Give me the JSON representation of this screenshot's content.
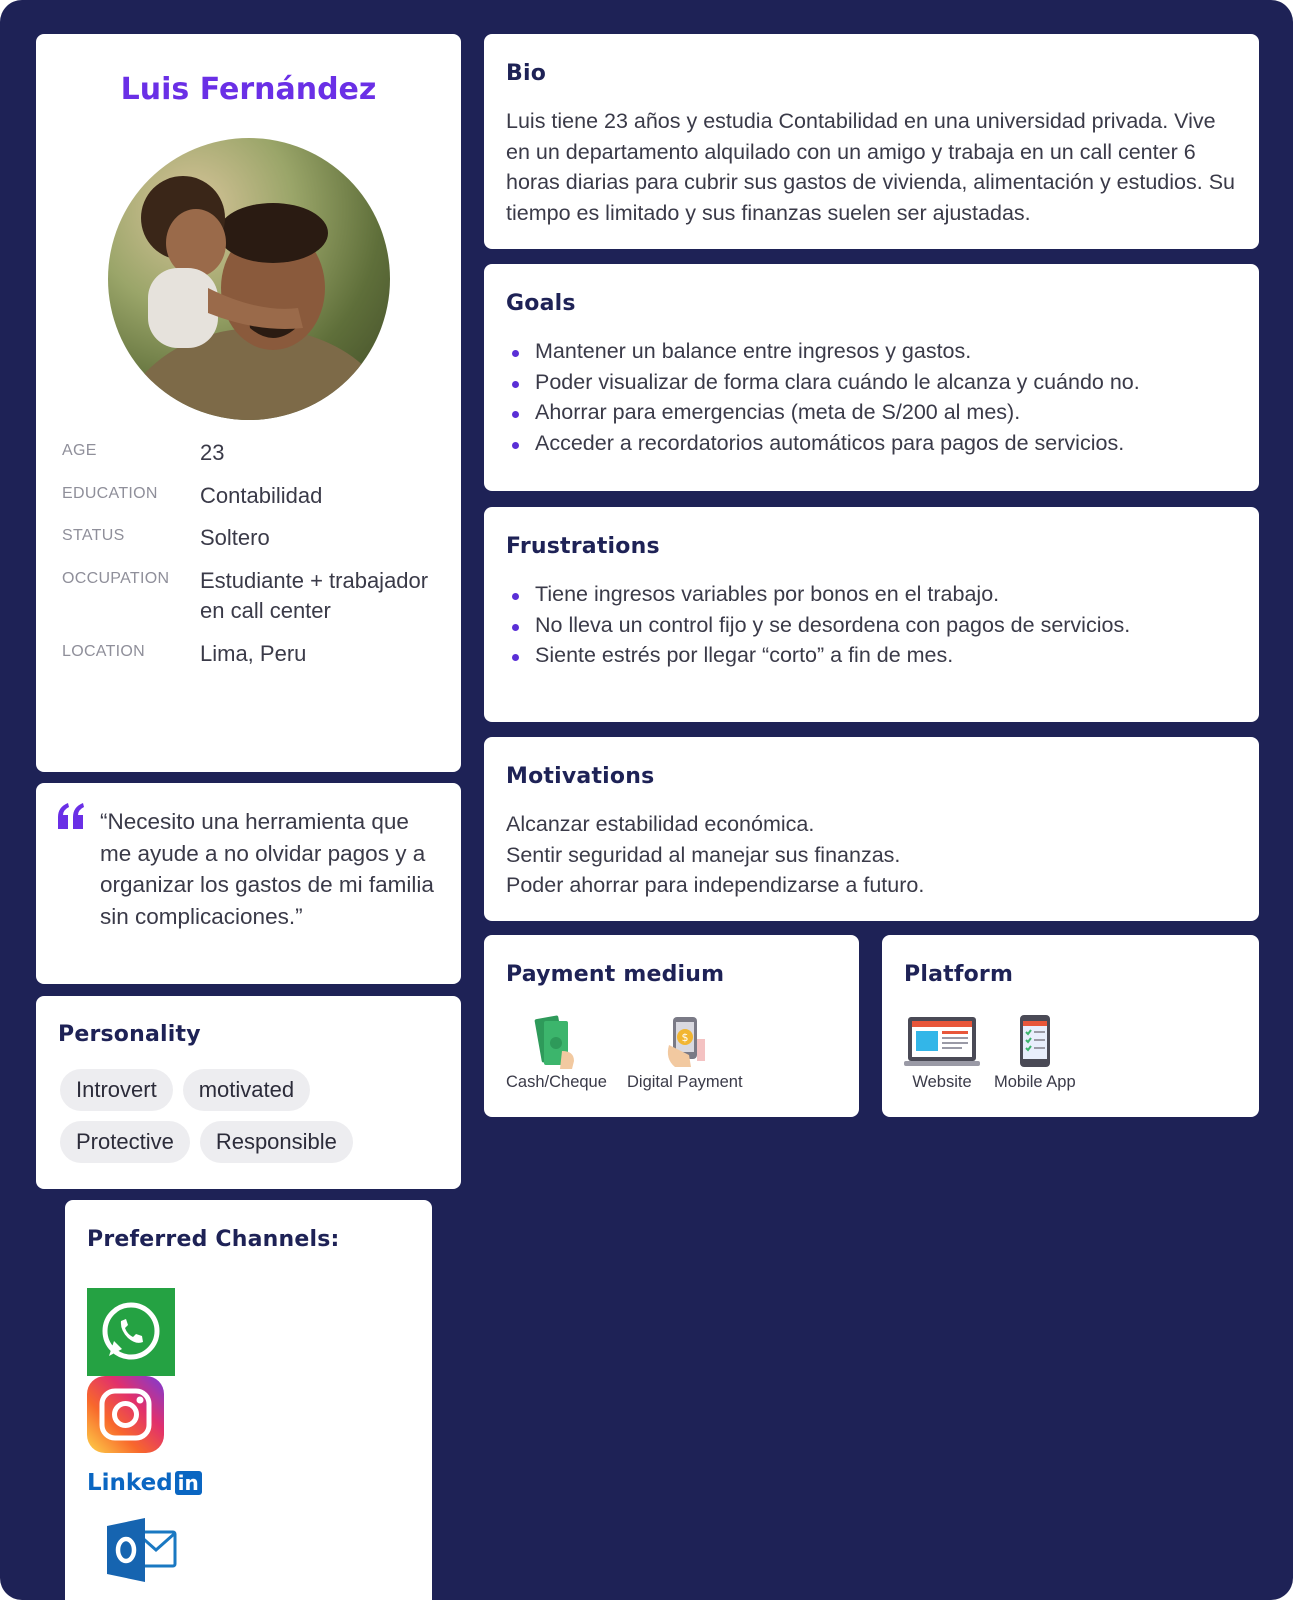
{
  "profile": {
    "name": "Luis Fernández",
    "photo_icon": "person-photo",
    "facts": [
      {
        "label": "AGE",
        "value": "23"
      },
      {
        "label": "EDUCATION",
        "value": "Contabilidad"
      },
      {
        "label": "STATUS",
        "value": "Soltero"
      },
      {
        "label": "OCCUPATION",
        "value": "Estudiante + trabajador en call center"
      },
      {
        "label": "LOCATION",
        "value": "Lima, Peru"
      }
    ]
  },
  "quote": {
    "icon": "quote-icon",
    "text": "“Necesito una herramienta que me ayude a no olvidar pagos y a organizar los gastos de mi familia sin complicaciones.”"
  },
  "personality": {
    "title": "Personality",
    "tags": [
      "Introvert",
      "motivated",
      "Protective",
      "Responsible"
    ]
  },
  "channels": {
    "title": "Preferred Channels:",
    "items": [
      "whatsapp-icon",
      "instagram-icon",
      "linkedin-logo",
      "outlook-icon"
    ],
    "linkedin_text": "Linked",
    "linkedin_in": "in"
  },
  "bio": {
    "title": "Bio",
    "text": "Luis tiene 23 años y estudia Contabilidad en una universidad privada. Vive en un departamento alquilado con un amigo y trabaja en un call center 6 horas diarias para cubrir sus gastos de vivienda, alimentación y estudios. Su tiempo es limitado y sus finanzas suelen ser ajustadas."
  },
  "goals": {
    "title": "Goals",
    "items": [
      "Mantener un balance entre ingresos y gastos.",
      "Poder visualizar de forma clara cuándo le alcanza y cuándo no.",
      "Ahorrar para emergencias (meta de S/200 al mes).",
      "Acceder a recordatorios automáticos para pagos de servicios."
    ]
  },
  "frustrations": {
    "title": "Frustrations",
    "items": [
      "Tiene ingresos variables por bonos en el trabajo.",
      "No lleva un control fijo y se desordena con pagos de servicios.",
      "Siente estrés por llegar “corto” a fin de mes."
    ]
  },
  "motivations": {
    "title": "Motivations",
    "lines": [
      "Alcanzar estabilidad económica.",
      "Sentir seguridad al manejar sus finanzas.",
      "Poder ahorrar para independizarse a futuro."
    ]
  },
  "payment": {
    "title": "Payment medium",
    "options": [
      {
        "label": "Cash/Cheque",
        "icon": "cash-icon"
      },
      {
        "label": "Digital Payment",
        "icon": "digital-payment-icon"
      }
    ]
  },
  "platform": {
    "title": "Platform",
    "options": [
      {
        "label": "Website",
        "icon": "website-icon"
      },
      {
        "label": "Mobile App",
        "icon": "mobile-app-icon"
      }
    ]
  },
  "colors": {
    "background": "#1e2256",
    "accent": "#6a2fe6",
    "heading": "#1e2256",
    "bullet": "#5a2fd6"
  }
}
